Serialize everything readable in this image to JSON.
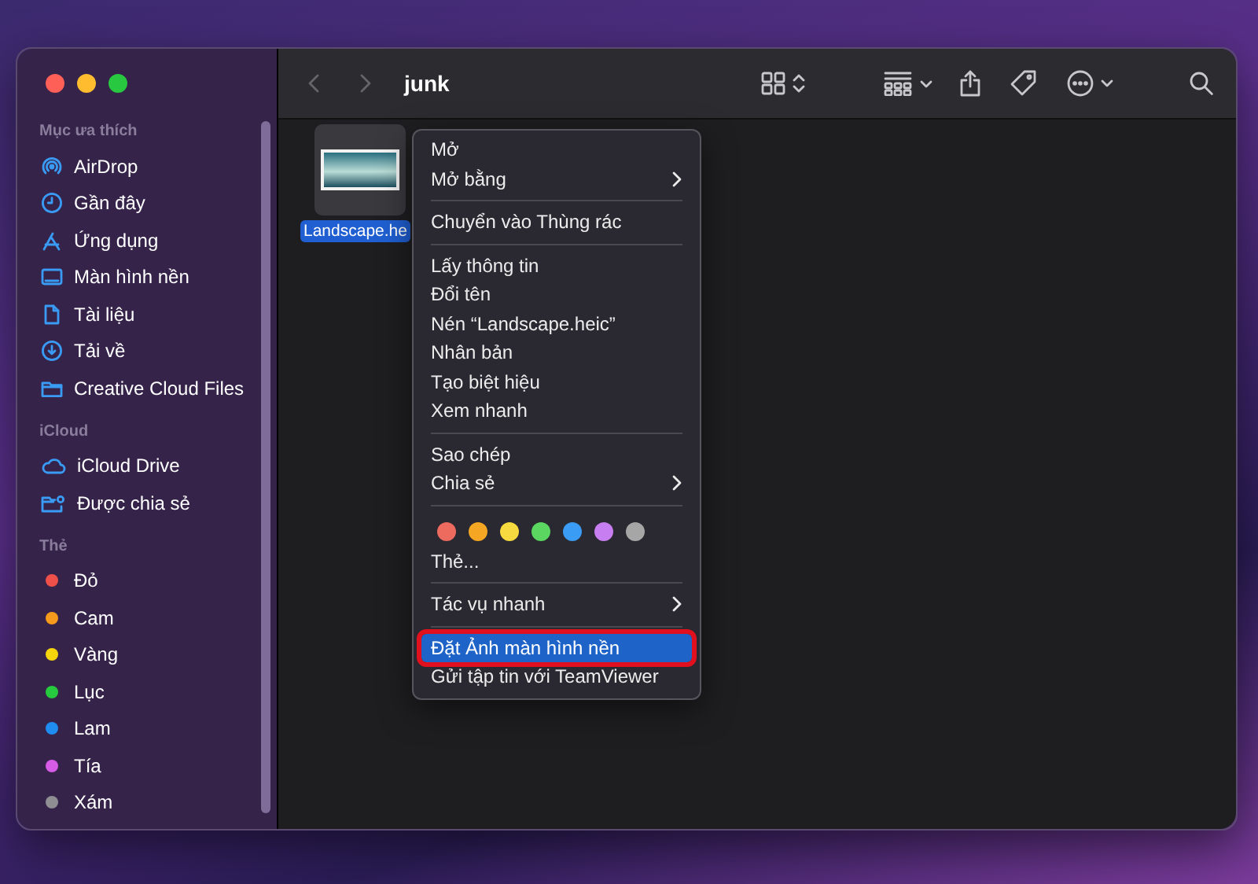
{
  "window": {
    "title": "junk"
  },
  "sidebar": {
    "sections": [
      {
        "title": "Mục ưa thích",
        "items": [
          {
            "label": "AirDrop",
            "kind": "airdrop"
          },
          {
            "label": "Gần đây",
            "kind": "clock"
          },
          {
            "label": "Ứng dụng",
            "kind": "apps"
          },
          {
            "label": "Màn hình nền",
            "kind": "desktop"
          },
          {
            "label": "Tài liệu",
            "kind": "document"
          },
          {
            "label": "Tải về",
            "kind": "download"
          },
          {
            "label": "Creative Cloud Files",
            "kind": "folder"
          }
        ]
      },
      {
        "title": "iCloud",
        "items": [
          {
            "label": "iCloud Drive",
            "kind": "cloud"
          },
          {
            "label": "Được chia sẻ",
            "kind": "shared"
          }
        ]
      },
      {
        "title": "Thẻ",
        "items": [
          {
            "label": "Đỏ",
            "kind": "tag",
            "color": "#f0504a"
          },
          {
            "label": "Cam",
            "kind": "tag",
            "color": "#f59a1c"
          },
          {
            "label": "Vàng",
            "kind": "tag",
            "color": "#f5d50c"
          },
          {
            "label": "Lục",
            "kind": "tag",
            "color": "#27c93f"
          },
          {
            "label": "Lam",
            "kind": "tag",
            "color": "#1f8cf0"
          },
          {
            "label": "Tía",
            "kind": "tag",
            "color": "#d65ce6"
          },
          {
            "label": "Xám",
            "kind": "tag",
            "color": "#8e8e93"
          }
        ]
      }
    ]
  },
  "files": [
    {
      "name": "Landscape.he",
      "selected": true
    }
  ],
  "context_menu": [
    {
      "kind": "item",
      "label": "Mở",
      "submenu": false,
      "highlighted": false,
      "annotated": false
    },
    {
      "kind": "item",
      "label": "Mở bằng",
      "submenu": true,
      "highlighted": false,
      "annotated": false
    },
    {
      "kind": "separator"
    },
    {
      "kind": "item",
      "label": "Chuyển vào Thùng rác",
      "submenu": false,
      "highlighted": false,
      "annotated": false
    },
    {
      "kind": "separator"
    },
    {
      "kind": "item",
      "label": "Lấy thông tin",
      "submenu": false,
      "highlighted": false,
      "annotated": false
    },
    {
      "kind": "item",
      "label": "Đổi tên",
      "submenu": false,
      "highlighted": false,
      "annotated": false
    },
    {
      "kind": "item",
      "label": "Nén “Landscape.heic”",
      "submenu": false,
      "highlighted": false,
      "annotated": false
    },
    {
      "kind": "item",
      "label": "Nhân bản",
      "submenu": false,
      "highlighted": false,
      "annotated": false
    },
    {
      "kind": "item",
      "label": "Tạo biệt hiệu",
      "submenu": false,
      "highlighted": false,
      "annotated": false
    },
    {
      "kind": "item",
      "label": "Xem nhanh",
      "submenu": false,
      "highlighted": false,
      "annotated": false
    },
    {
      "kind": "separator"
    },
    {
      "kind": "item",
      "label": "Sao chép",
      "submenu": false,
      "highlighted": false,
      "annotated": false
    },
    {
      "kind": "item",
      "label": "Chia sẻ",
      "submenu": true,
      "highlighted": false,
      "annotated": false
    },
    {
      "kind": "separator"
    },
    {
      "kind": "tags",
      "colors": [
        {
          "color": "#ec6a5e"
        },
        {
          "color": "#f5a623"
        },
        {
          "color": "#f7d940"
        },
        {
          "color": "#5ad661"
        },
        {
          "color": "#3b9cf5"
        },
        {
          "color": "#c77ef0"
        },
        {
          "color": "#a6a6a6"
        }
      ]
    },
    {
      "kind": "item",
      "label": "Thẻ...",
      "submenu": false,
      "highlighted": false,
      "annotated": false
    },
    {
      "kind": "separator"
    },
    {
      "kind": "item",
      "label": "Tác vụ nhanh",
      "submenu": true,
      "highlighted": false,
      "annotated": false
    },
    {
      "kind": "separator"
    },
    {
      "kind": "item",
      "label": "Đặt Ảnh màn hình nền",
      "submenu": false,
      "highlighted": true,
      "annotated": true
    },
    {
      "kind": "item",
      "label": "Gửi tập tin với TeamViewer",
      "submenu": false,
      "highlighted": false,
      "annotated": false
    }
  ]
}
